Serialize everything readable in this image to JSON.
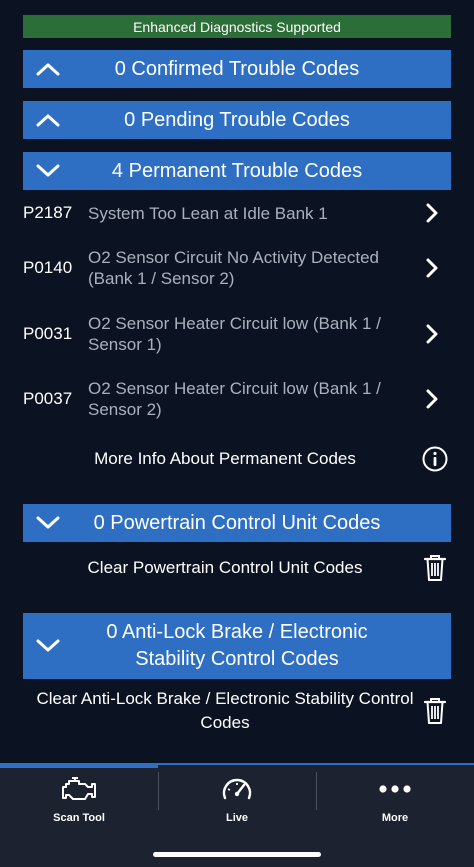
{
  "banner": {
    "text": "Enhanced Diagnostics Supported"
  },
  "sections": {
    "confirmed": {
      "title": "0 Confirmed Trouble Codes",
      "state": "expanded",
      "icon": "chevron-up-icon"
    },
    "pending": {
      "title": "0 Pending Trouble Codes",
      "state": "expanded",
      "icon": "chevron-up-icon"
    },
    "permanent": {
      "title": "4 Permanent Trouble Codes",
      "state": "collapsed",
      "icon": "chevron-down-icon"
    },
    "powertrain": {
      "title": "0 Powertrain Control Unit Codes",
      "state": "collapsed",
      "icon": "chevron-down-icon"
    },
    "abs": {
      "title": "0 Anti-Lock Brake / Electronic Stability Control Codes",
      "state": "collapsed",
      "icon": "chevron-down-icon"
    }
  },
  "permanent_codes": [
    {
      "code": "P2187",
      "description": "System Too Lean at Idle Bank 1"
    },
    {
      "code": "P0140",
      "description": "O2 Sensor Circuit No Activity Detected (Bank 1 / Sensor 2)"
    },
    {
      "code": "P0031",
      "description": "O2 Sensor Heater Circuit low (Bank 1 / Sensor 1)"
    },
    {
      "code": "P0037",
      "description": "O2 Sensor Heater Circuit low (Bank 1 / Sensor 2)"
    }
  ],
  "actions": {
    "more_info": {
      "label": "More Info About Permanent Codes",
      "icon": "info-icon"
    },
    "clear_powertrain": {
      "label": "Clear Powertrain Control Unit Codes",
      "icon": "trash-icon"
    },
    "clear_abs": {
      "label": "Clear Anti-Lock Brake / Electronic Stability Control Codes",
      "icon": "trash-icon"
    }
  },
  "tabs": [
    {
      "label": "Scan Tool",
      "icon": "engine-icon",
      "active": true
    },
    {
      "label": "Live",
      "icon": "gauge-icon",
      "active": false
    },
    {
      "label": "More",
      "icon": "more-dots-icon",
      "active": false
    }
  ],
  "colors": {
    "background": "#0b1322",
    "banner_green": "#2b6e37",
    "section_blue": "#2e6fc4",
    "tabbar": "#1c2230",
    "muted_text": "#a9b1bd"
  }
}
